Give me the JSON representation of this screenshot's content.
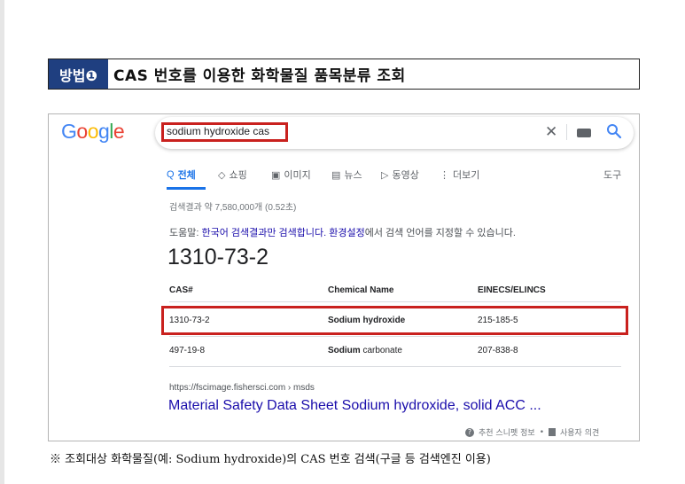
{
  "method": {
    "badge": "방법❶",
    "title": "CAS 번호를 이용한 화학물질 품목분류 조회"
  },
  "google": {
    "logo": [
      "G",
      "o",
      "o",
      "g",
      "l",
      "e"
    ],
    "search": {
      "query": "sodium hydroxide cas",
      "clear_icon": "close-icon",
      "keyboard_icon": "keyboard-icon",
      "search_icon": "magnifier-icon"
    },
    "tabs": [
      {
        "label": "전체",
        "icon": "Q",
        "active": true
      },
      {
        "label": "쇼핑",
        "icon": "◇"
      },
      {
        "label": "이미지",
        "icon": "▣"
      },
      {
        "label": "뉴스",
        "icon": "▤"
      },
      {
        "label": "동영상",
        "icon": "▷"
      },
      {
        "label": "더보기",
        "icon": "⋮"
      }
    ],
    "tools": "도구",
    "stats": "검색결과 약 7,580,000개 (0.52초)",
    "help": {
      "prefix": "도움말: ",
      "link1": "한국어 검색결과만 검색합니다.",
      "link2": "환경설정",
      "suffix": "에서 검색 언어를 지정할 수 있습니다."
    },
    "answer": "1310-73-2",
    "table": {
      "headers": [
        "CAS#",
        "Chemical Name",
        "EINECS/ELINCS"
      ],
      "rows": [
        {
          "cas": "1310-73-2",
          "name_bold": "Sodium",
          "name_rest": " hydroxide",
          "einecs": "215-185-5"
        },
        {
          "cas": "497-19-8",
          "name_bold": "Sodium",
          "name_rest": " carbonate",
          "einecs": "207-838-8"
        }
      ]
    },
    "result": {
      "url": "https://fscimage.fishersci.com › msds",
      "title": "Material Safety Data Sheet Sodium hydroxide, solid ACC ..."
    },
    "footer": {
      "snippet_info": "추천 스니펫 정보",
      "feedback": "사용자 의견"
    }
  },
  "caption": "※ 조회대상 화학물질(예: Sodium hydroxide)의 CAS 번호 검색(구글 등 검색엔진 이용)",
  "colors": {
    "badge_bg": "#1f3f80",
    "highlight": "#c9211e",
    "link": "#1a0dab",
    "active_tab": "#1a73e8"
  }
}
